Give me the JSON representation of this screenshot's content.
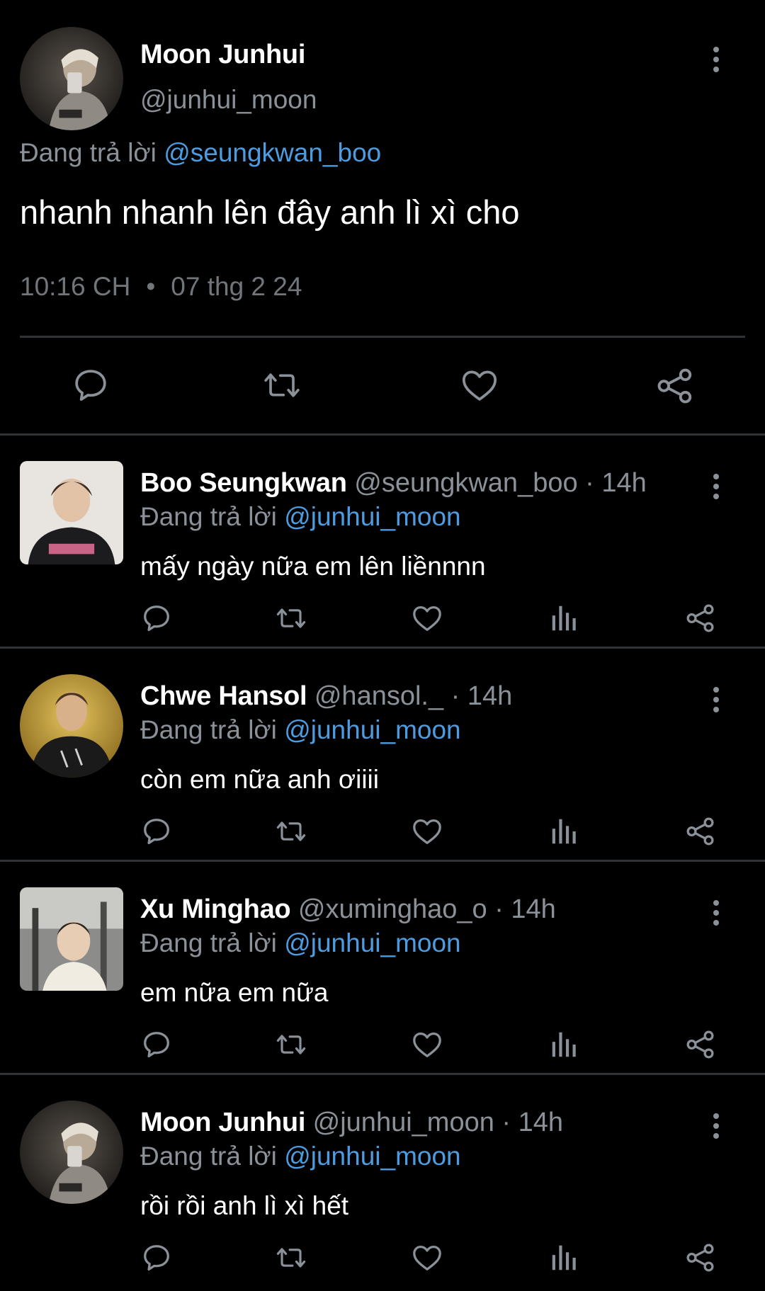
{
  "main_tweet": {
    "author_name": "Moon Junhui",
    "author_handle": "@junhui_moon",
    "reply_prefix": "Đang trả lời",
    "reply_to": "@seungkwan_boo",
    "text": "nhanh nhanh lên đây anh lì xì cho",
    "time": "10:16 CH",
    "separator": "•",
    "date": "07 thg 2 24",
    "actions": [
      "reply-icon",
      "retweet-icon",
      "like-icon",
      "share-icon"
    ]
  },
  "replies": [
    {
      "name": "Boo Seungkwan",
      "handle": "@seungkwan_boo",
      "separator": "·",
      "time": "14h",
      "reply_prefix": "Đang trả lời",
      "reply_to": "@junhui_moon",
      "text": "mấy ngày nữa em lên liềnnnn"
    },
    {
      "name": "Chwe Hansol",
      "handle": "@hansol._",
      "separator": "·",
      "time": "14h",
      "reply_prefix": "Đang trả lời",
      "reply_to": "@junhui_moon",
      "text": "còn em nữa anh ơiiii"
    },
    {
      "name": "Xu Minghao",
      "handle": "@xuminghao_o",
      "separator": "·",
      "time": "14h",
      "reply_prefix": "Đang trả lời",
      "reply_to": "@junhui_moon",
      "text": "em nữa em nữa"
    },
    {
      "name": "Moon Junhui",
      "handle": "@junhui_moon",
      "separator": "·",
      "time": "14h",
      "reply_prefix": "Đang trả lời",
      "reply_to": "@junhui_moon",
      "text": "rồi rồi anh lì xì hết"
    }
  ],
  "reply_actions": [
    "reply-icon",
    "retweet-icon",
    "like-icon",
    "views-icon",
    "share-icon"
  ],
  "colors": {
    "background": "#000000",
    "text": "#ffffff",
    "muted": "#8b9198",
    "mention": "#4d9ce0",
    "divider": "#2f3336",
    "icon": "#8b9198"
  }
}
